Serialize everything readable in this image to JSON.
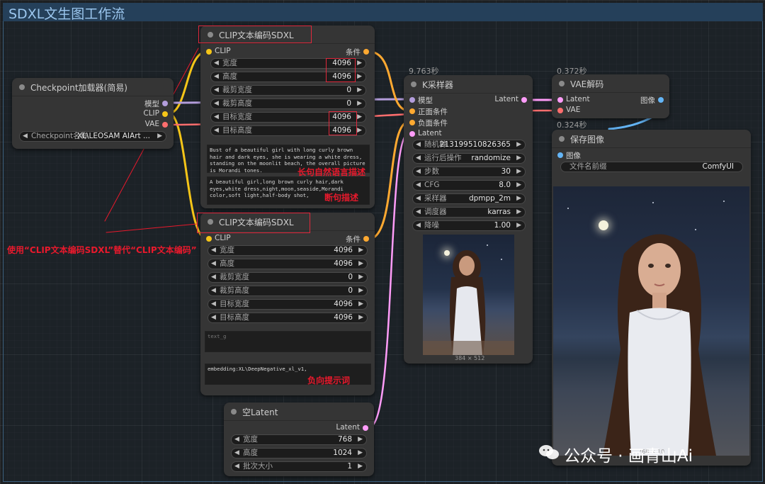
{
  "workflow": {
    "title": "SDXL文生图工作流"
  },
  "checkpoint_node": {
    "title": "Checkpoint加载器(简易)",
    "outputs": [
      "模型",
      "CLIP",
      "VAE"
    ],
    "widget": {
      "label": "Checkpoint名称",
      "value": "XL\\LEOSAM AIArt ..."
    }
  },
  "clip_node_pos": {
    "title": "CLIP文本编码SDXL",
    "input": "CLIP",
    "output": "条件",
    "widgets": [
      {
        "label": "宽度",
        "value": "4096"
      },
      {
        "label": "高度",
        "value": "4096"
      },
      {
        "label": "裁剪宽度",
        "value": "0"
      },
      {
        "label": "裁剪高度",
        "value": "0"
      },
      {
        "label": "目标宽度",
        "value": "4096"
      },
      {
        "label": "目标高度",
        "value": "4096"
      }
    ],
    "text_g": "Bust of a beautiful girl with long curly brown hair and dark eyes, she is wearing a white dress, standing on the moonlit beach, the overall picture is Morandi tones.",
    "text_l": "A beautiful girl,long brown curly hair,dark eyes,white dress,night,moon,seaside,Morandi color,soft light,half-body shot,"
  },
  "clip_node_neg": {
    "title": "CLIP文本编码SDXL",
    "input": "CLIP",
    "output": "条件",
    "widgets": [
      {
        "label": "宽度",
        "value": "4096"
      },
      {
        "label": "高度",
        "value": "4096"
      },
      {
        "label": "裁剪宽度",
        "value": "0"
      },
      {
        "label": "裁剪高度",
        "value": "0"
      },
      {
        "label": "目标宽度",
        "value": "4096"
      },
      {
        "label": "目标高度",
        "value": "4096"
      }
    ],
    "text_g_placeholder": "text_g",
    "text_l": "embedding:XL\\DeepNegative_xl_v1,"
  },
  "ksampler_node": {
    "time": "9.763秒",
    "title": "K采样器",
    "inputs": [
      "模型",
      "正面条件",
      "负面条件",
      "Latent"
    ],
    "output": "Latent",
    "widgets": [
      {
        "label": "随机种",
        "value": "213199510826365"
      },
      {
        "label": "运行后操作",
        "value": "randomize"
      },
      {
        "label": "步数",
        "value": "30"
      },
      {
        "label": "CFG",
        "value": "8.0"
      },
      {
        "label": "采样器",
        "value": "dpmpp_2m"
      },
      {
        "label": "调度器",
        "value": "karras"
      },
      {
        "label": "降噪",
        "value": "1.00"
      }
    ],
    "preview_size": "384 × 512"
  },
  "vae_node": {
    "time": "0.372秒",
    "title": "VAE解码",
    "inputs": [
      "Latent",
      "VAE"
    ],
    "output": "图像"
  },
  "save_node": {
    "time": "0.324秒",
    "title": "保存图像",
    "input": "图像",
    "widget": {
      "label": "文件名前缀",
      "value": "ComfyUI"
    },
    "image_size": "768 × 10"
  },
  "latent_node": {
    "title": "空Latent",
    "output": "Latent",
    "widgets": [
      {
        "label": "宽度",
        "value": "768"
      },
      {
        "label": "高度",
        "value": "1024"
      },
      {
        "label": "批次大小",
        "value": "1"
      }
    ]
  },
  "annotations": {
    "long_desc": "长句自然语言描述",
    "short_desc": "断句描述",
    "negative": "负向提示词",
    "replace_note": "使用“CLIP文本编码SDXL”替代“CLIP文本编码”"
  },
  "watermark": {
    "text": "公众号 · 画青山Ai"
  },
  "colors": {
    "clip_wire": "#f5c518",
    "model_wire": "#b39ddb",
    "vae_wire": "#ff6e6e",
    "cond_wire": "#ffa931",
    "latent_wire": "#ff9cf9",
    "image_wire": "#64b5f6",
    "annotation": "#e8192c"
  }
}
